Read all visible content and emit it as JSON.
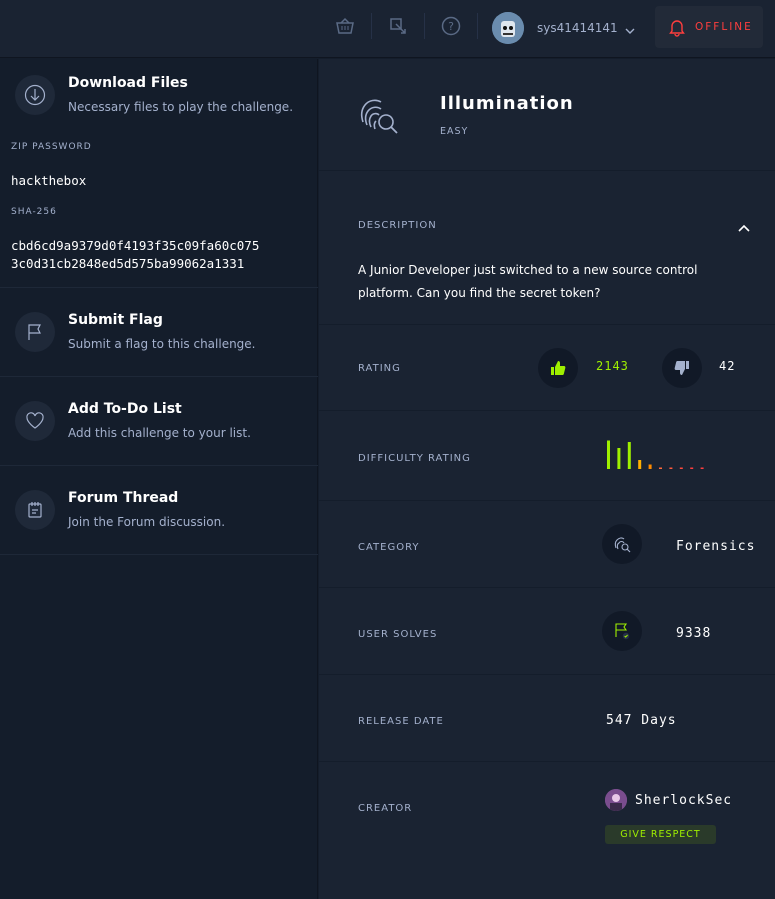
{
  "topbar": {
    "username": "sys41414141",
    "status_label": "OFFLINE",
    "icons": [
      "basket-icon",
      "vpn-icon",
      "help-icon",
      "bell-icon"
    ]
  },
  "left": {
    "download": {
      "title": "Download Files",
      "subtitle": "Necessary files to play the challenge.",
      "zip_password_label": "ZIP PASSWORD",
      "zip_password": "hackthebox",
      "sha_label": "SHA-256",
      "sha_line1": "cbd6cd9a9379d0f4193f35c09fa60c075",
      "sha_line2": "3c0d31cb2848ed5d575ba99062a1331"
    },
    "submit": {
      "title": "Submit Flag",
      "subtitle": "Submit a flag to this challenge."
    },
    "todo": {
      "title": "Add To-Do List",
      "subtitle": "Add this challenge to your list."
    },
    "forum": {
      "title": "Forum Thread",
      "subtitle": "Join the Forum discussion."
    }
  },
  "challenge": {
    "name": "Illumination",
    "difficulty": "EASY",
    "description_label": "DESCRIPTION",
    "description": "A Junior Developer just switched to a new source control platform. Can you find the secret token?",
    "rating_label": "RATING",
    "likes": "2143",
    "dislikes": "42",
    "difficulty_rating_label": "DIFFICULTY RATING",
    "difficulty_bars": [
      0.95,
      0.7,
      0.9,
      0.3,
      0.15,
      0.03,
      0.03,
      0.03,
      0.03,
      0.03
    ],
    "category_label": "CATEGORY",
    "category": "Forensics",
    "user_solves_label": "USER SOLVES",
    "user_solves": "9338",
    "release_date_label": "RELEASE DATE",
    "release_date": "547 Days",
    "creator_label": "CREATOR",
    "creator": "SherlockSec",
    "give_respect": "GIVE RESPECT"
  },
  "colors": {
    "accent_green": "#9fef00",
    "offline_red": "#ff3e3e",
    "bg_dark": "#141d2b",
    "bg_panel": "#1a2332"
  }
}
